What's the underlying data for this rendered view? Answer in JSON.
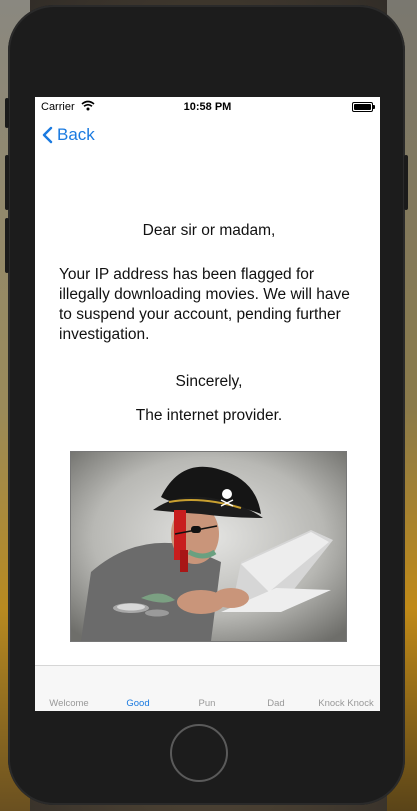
{
  "status": {
    "carrier": "Carrier",
    "time": "10:58 PM"
  },
  "nav": {
    "back_label": "Back"
  },
  "letter": {
    "greeting": "Dear sir or madam,",
    "body": "Your IP address has been flagged for illegally downloading movies. We will have to suspend your account, pending further investigation.",
    "closing": "Sincerely,",
    "signature": "The internet provider."
  },
  "tabs": [
    {
      "label": "Welcome",
      "active": false
    },
    {
      "label": "Good",
      "active": true
    },
    {
      "label": "Pun",
      "active": false
    },
    {
      "label": "Dad",
      "active": false
    },
    {
      "label": "Knock Knock",
      "active": false
    }
  ],
  "colors": {
    "accent": "#1a7ae0",
    "inactive_tab": "#999999"
  }
}
